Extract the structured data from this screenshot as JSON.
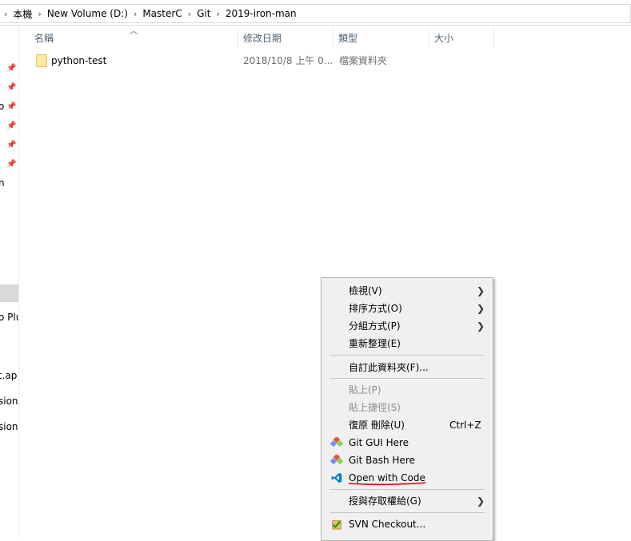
{
  "address": {
    "crumbs": [
      "本機",
      "New Volume (D:)",
      "MasterC",
      "Git",
      "2019-iron-man"
    ]
  },
  "nav": {
    "fragments": [
      "o",
      "n",
      "o Plu",
      "c.ap",
      "sion",
      "sion"
    ]
  },
  "columns": {
    "name": "名稱",
    "modified": "修改日期",
    "type": "類型",
    "size": "大小"
  },
  "files": [
    {
      "name": "python-test",
      "modified": "2018/10/8 上午 0...",
      "type": "檔案資料夾",
      "size": ""
    }
  ],
  "menu": {
    "view": "檢視(V)",
    "sort": "排序方式(O)",
    "group": "分組方式(P)",
    "refresh": "重新整理(E)",
    "customize": "自訂此資料夾(F)...",
    "paste": "貼上(P)",
    "paste_shortcut": "貼上捷徑(S)",
    "undo": "復原 刪除(U)",
    "undo_shortcut": "Ctrl+Z",
    "git_gui": "Git GUI Here",
    "git_bash": "Git Bash Here",
    "open_code": "Open with Code",
    "grant_access": "授與存取權給(G)",
    "svn_checkout": "SVN Checkout..."
  },
  "colors": {
    "header_text": "#4c607a",
    "annotation_underline": "#e00000",
    "vscode_blue": "#0078d4"
  }
}
